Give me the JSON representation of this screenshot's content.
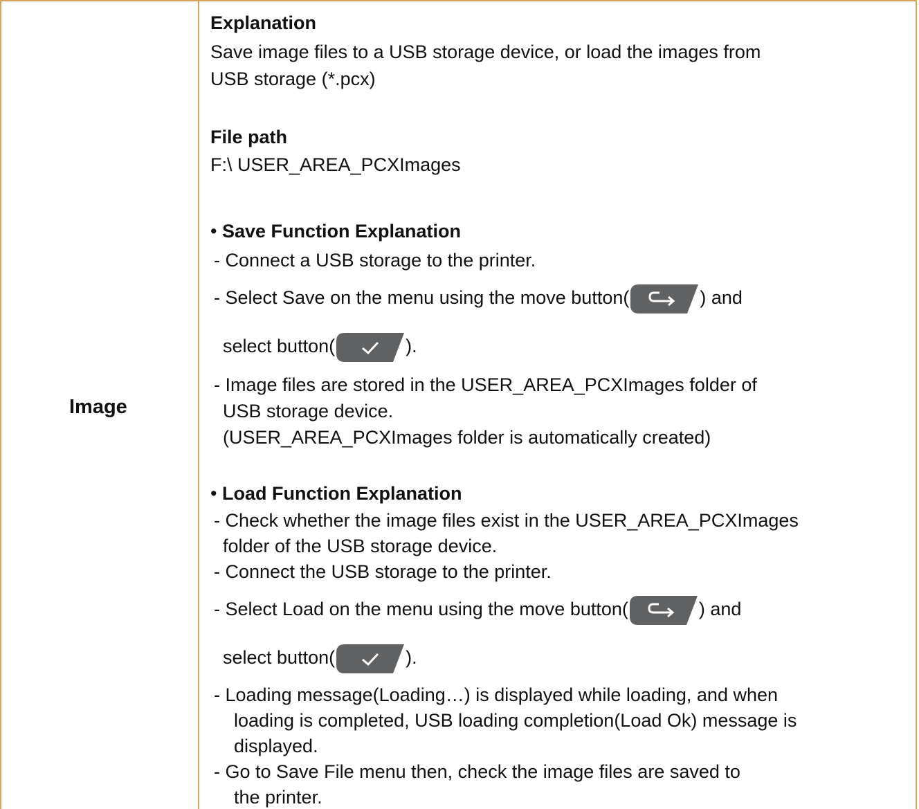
{
  "row_label": "Image",
  "explanation": {
    "heading": "Explanation",
    "line1": "Save image files to a USB storage device, or load the images from",
    "line2": "USB storage (*.pcx)"
  },
  "file_path": {
    "heading": "File path",
    "value": "F:\\ USER_AREA_PCXImages"
  },
  "save": {
    "bullet": "•",
    "heading": "Save Function Explanation",
    "step1": "- Connect a USB storage to the printer.",
    "step2_pre": "- Select Save on the menu using the move button(",
    "step2_post": ") and",
    "step2b_pre": "select button(",
    "step2b_post": ").",
    "step3_l1": "- Image files are stored in the USER_AREA_PCXImages folder of",
    "step3_l2": "USB storage device.",
    "step3_l3": "(USER_AREA_PCXImages folder is automatically created)"
  },
  "load": {
    "bullet": "•",
    "heading": "Load Function Explanation",
    "step1_l1": "- Check whether the image files exist in the USER_AREA_PCXImages",
    "step1_l2": "folder of the USB storage device.",
    "step2": "- Connect the USB storage to the printer.",
    "step3_pre": "- Select Load on the menu using the move button(",
    "step3_post": ") and",
    "step3b_pre": "select button(",
    "step3b_post": ").",
    "step4_l1": "- Loading message(Loading…) is displayed while loading, and when",
    "step4_l2": "loading is completed, USB loading completion(Load Ok) message is",
    "step4_l3": "displayed.",
    "step5_l1": "- Go to Save File menu then, check the image files are saved to",
    "step5_l2": "the printer."
  },
  "icons": {
    "move_button": "move-button-icon",
    "select_button": "select-button-icon",
    "button_color": "#5f6163",
    "border_color": "#d7a25a"
  }
}
